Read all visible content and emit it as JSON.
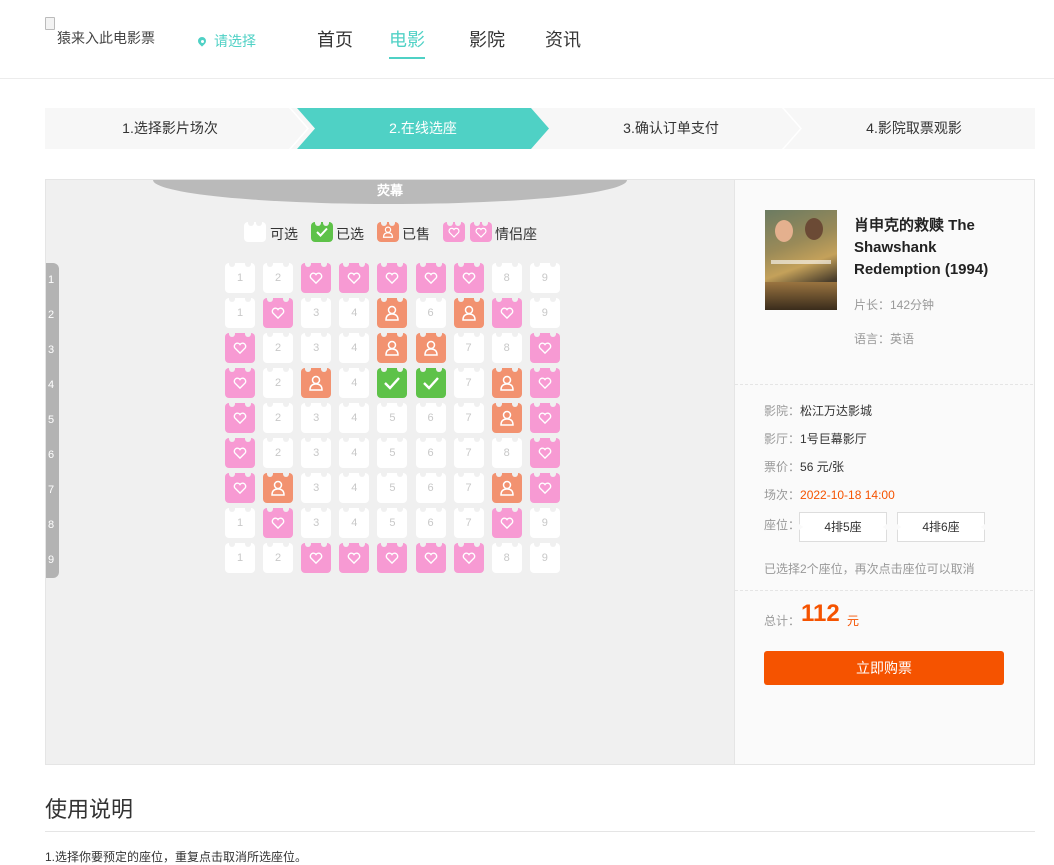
{
  "header": {
    "logo_alt": "猿来入此电影票",
    "city": "请选择",
    "nav": [
      {
        "label": "首页",
        "active": false
      },
      {
        "label": "电影",
        "active": true
      },
      {
        "label": "影院",
        "active": false
      },
      {
        "label": "资讯",
        "active": false
      }
    ]
  },
  "steps": [
    {
      "label": "1.选择影片场次",
      "active": false
    },
    {
      "label": "2.在线选座",
      "active": true
    },
    {
      "label": "3.确认订单支付",
      "active": false
    },
    {
      "label": "4.影院取票观影",
      "active": false
    }
  ],
  "hall": {
    "screen_label": "荧幕",
    "legend": {
      "available": "可选",
      "selected": "已选",
      "sold": "已售",
      "couple": "情侣座"
    },
    "row_labels": [
      "1",
      "2",
      "3",
      "4",
      "5",
      "6",
      "7",
      "8",
      "9"
    ],
    "rows": [
      [
        "E1",
        "E2",
        "L",
        "L",
        "L",
        "L",
        "L",
        "E8",
        "E9"
      ],
      [
        "E1",
        "L",
        "E3",
        "E4",
        "S",
        "E6",
        "S",
        "L",
        "E9"
      ],
      [
        "L",
        "E2",
        "E3",
        "E4",
        "S",
        "S",
        "E7",
        "E8",
        "L"
      ],
      [
        "L",
        "E2",
        "S",
        "E4",
        "C",
        "C",
        "E7",
        "S",
        "L"
      ],
      [
        "L",
        "E2",
        "E3",
        "E4",
        "E5",
        "E6",
        "E7",
        "S",
        "L"
      ],
      [
        "L",
        "E2",
        "E3",
        "E4",
        "E5",
        "E6",
        "E7",
        "E8",
        "L"
      ],
      [
        "L",
        "S",
        "E3",
        "E4",
        "E5",
        "E6",
        "E7",
        "S",
        "L"
      ],
      [
        "E1",
        "L",
        "E3",
        "E4",
        "E5",
        "E6",
        "E7",
        "L",
        "E9"
      ],
      [
        "E1",
        "E2",
        "L",
        "L",
        "L",
        "L",
        "L",
        "E8",
        "E9"
      ]
    ],
    "colors": {
      "available": "#ffffff",
      "selected": "#5ec249",
      "sold": "#f29270",
      "couple": "#f79ad3"
    }
  },
  "movie": {
    "title": "肖申克的救赎 The Shawshank Redemption (1994)",
    "duration": "片长：142分钟",
    "language": "语言：英语"
  },
  "order": {
    "cinema_label": "影院：",
    "cinema": "松江万达影城",
    "hall_label": "影厅：",
    "hall": "1号巨幕影厅",
    "price_label": "票价：",
    "price": "56 元/张",
    "time_label": "场次：",
    "time": "2022-10-18 14:00",
    "seats_label": "座位：",
    "seats": [
      "4排5座",
      "4排6座"
    ],
    "hint": "已选择2个座位，再次点击座位可以取消",
    "total_label": "总计：",
    "total_value": "112",
    "total_unit": "元",
    "buy_label": "立即购票",
    "accent": "#f55300"
  },
  "usage": {
    "title": "使用说明",
    "line1": "1.选择你要预定的座位，重复点击取消所选座位。"
  }
}
